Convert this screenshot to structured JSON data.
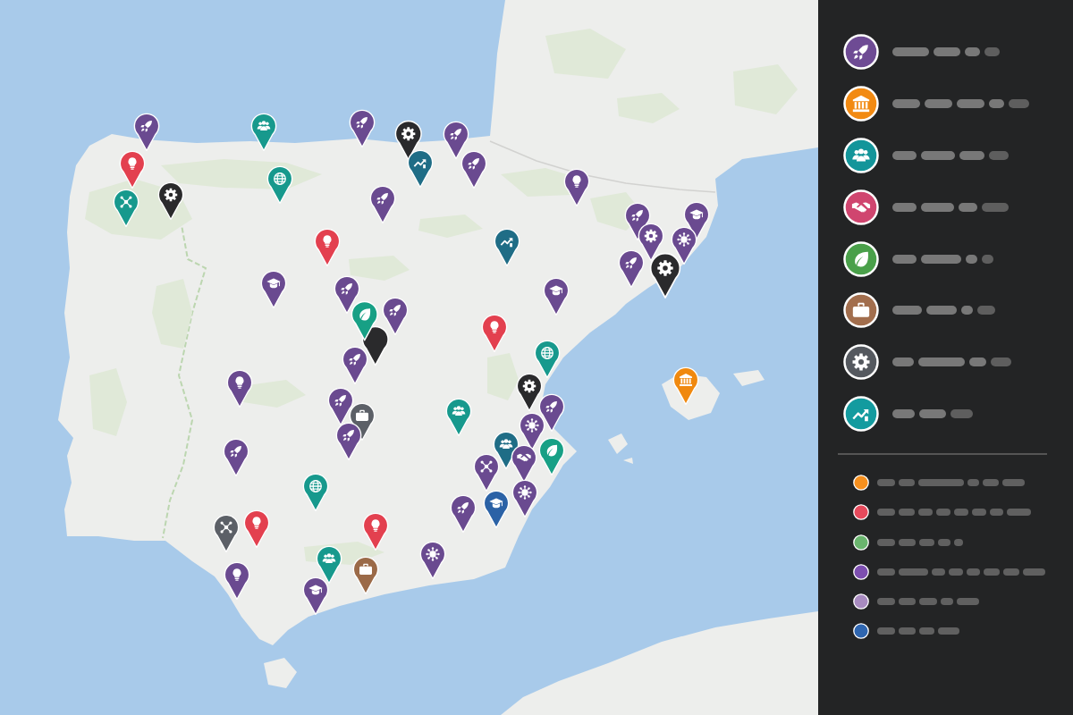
{
  "map": {
    "pins": [
      {
        "kind": "rocket",
        "color": "#6a4a90"
      },
      {
        "kind": "people",
        "color": "#17998d"
      },
      {
        "kind": "rocket",
        "color": "#6a4a90"
      },
      {
        "kind": "gear",
        "color": "#2a2a2c"
      },
      {
        "kind": "rocket",
        "color": "#6a4a90"
      },
      {
        "kind": "chart",
        "color": "#1f6d86"
      },
      {
        "kind": "rocket",
        "color": "#6a4a90"
      },
      {
        "kind": "bulb",
        "color": "#e3404f"
      },
      {
        "kind": "network",
        "color": "#17998d"
      },
      {
        "kind": "gear",
        "color": "#2a2a2c"
      },
      {
        "kind": "globe",
        "color": "#17998d"
      },
      {
        "kind": "rocket",
        "color": "#6a4a90"
      },
      {
        "kind": "bulb",
        "color": "#6a4a90"
      },
      {
        "kind": "bulb",
        "color": "#e3404f"
      },
      {
        "kind": "chart",
        "color": "#1f6d86"
      },
      {
        "kind": "rocket",
        "color": "#6a4a90"
      },
      {
        "kind": "graduation",
        "color": "#6a4a90"
      },
      {
        "kind": "gear",
        "color": "#6a4a90"
      },
      {
        "kind": "virus",
        "color": "#6a4a90"
      },
      {
        "kind": "rocket",
        "color": "#6a4a90"
      },
      {
        "kind": "gear",
        "color": "#2a2a2c"
      },
      {
        "kind": "graduation",
        "color": "#6a4a90"
      },
      {
        "kind": "rocket",
        "color": "#6a4a90"
      },
      {
        "kind": "graduation",
        "color": "#6a4a90"
      },
      {
        "kind": "rocket",
        "color": "#6a4a90"
      },
      {
        "color": "#2a2a2c"
      },
      {
        "kind": "leaf",
        "color": "#17a085"
      },
      {
        "kind": "bulb",
        "color": "#e3404f"
      },
      {
        "kind": "globe",
        "color": "#17998d"
      },
      {
        "kind": "rocket",
        "color": "#6a4a90"
      },
      {
        "kind": "gear",
        "color": "#2a2a2c"
      },
      {
        "kind": "bulb",
        "color": "#6a4a90"
      },
      {
        "kind": "rocket",
        "color": "#6a4a90"
      },
      {
        "kind": "briefcase",
        "color": "#5c6067"
      },
      {
        "kind": "people",
        "color": "#17998d"
      },
      {
        "kind": "rocket",
        "color": "#6a4a90"
      },
      {
        "kind": "virus",
        "color": "#6a4a90"
      },
      {
        "kind": "rocket",
        "color": "#6a4a90"
      },
      {
        "kind": "rocket",
        "color": "#6a4a90"
      },
      {
        "kind": "people",
        "color": "#1f6d86"
      },
      {
        "kind": "handshake",
        "color": "#6a4a90"
      },
      {
        "kind": "leaf",
        "color": "#17a085"
      },
      {
        "kind": "network",
        "color": "#6a4a90"
      },
      {
        "kind": "virus",
        "color": "#6a4a90"
      },
      {
        "kind": "graduation",
        "color": "#2b62a6"
      },
      {
        "kind": "globe",
        "color": "#17998d"
      },
      {
        "kind": "rocket",
        "color": "#6a4a90"
      },
      {
        "kind": "network",
        "color": "#5c6067"
      },
      {
        "kind": "bulb",
        "color": "#e3404f"
      },
      {
        "kind": "bulb",
        "color": "#e3404f"
      },
      {
        "kind": "virus",
        "color": "#6a4a90"
      },
      {
        "kind": "people",
        "color": "#17998d"
      },
      {
        "kind": "briefcase",
        "color": "#9b6a48"
      },
      {
        "kind": "bulb",
        "color": "#6a4a90"
      },
      {
        "kind": "graduation",
        "color": "#6a4a90"
      },
      {
        "kind": "bank",
        "color": "#f0890f"
      }
    ]
  },
  "legend": {
    "categories": [
      {
        "kind": "rocket",
        "color": "#6e4b94"
      },
      {
        "kind": "bank",
        "color": "#f28a12"
      },
      {
        "kind": "people",
        "color": "#13959a"
      },
      {
        "kind": "handshake",
        "color": "#d0456f"
      },
      {
        "kind": "leaf",
        "color": "#4aa04a"
      },
      {
        "kind": "briefcase",
        "color": "#a26e4d"
      },
      {
        "kind": "gear",
        "color": "#55595f"
      },
      {
        "kind": "chart",
        "color": "#139b9f"
      }
    ],
    "swatches": [
      {
        "color": "#f7901e"
      },
      {
        "color": "#e64a5c"
      },
      {
        "color": "#6ab56e"
      },
      {
        "color": "#7d4fb0"
      },
      {
        "color": "#a88bc0"
      },
      {
        "color": "#2f66b0"
      }
    ]
  }
}
